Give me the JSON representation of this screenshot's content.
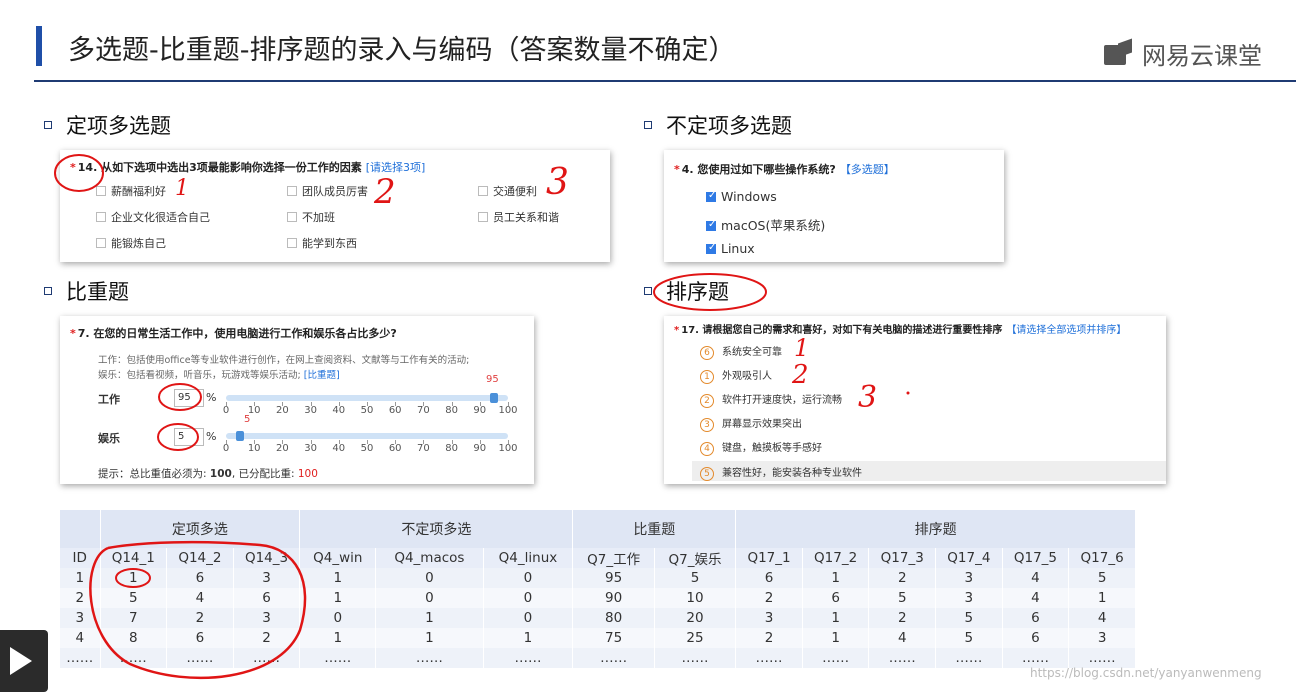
{
  "title": "多选题-比重题-排序题的录入与编码（答案数量不确定）",
  "brand": "网易云课堂",
  "sections": {
    "fixed_multi": "定项多选题",
    "open_multi": "不定项多选题",
    "weight": "比重题",
    "rank": "排序题"
  },
  "q14": {
    "req": "*",
    "label": "14. 从如下选项中选出3项最能影响你选择一份工作的因素",
    "tag": "[请选择3项]",
    "options": [
      "薪酬福利好",
      "团队成员厉害",
      "交通便利",
      "企业文化很适合自己",
      "不加班",
      "员工关系和谐",
      "能锻炼自己",
      "能学到东西"
    ]
  },
  "q4": {
    "req": "*",
    "label": "4.   您使用过如下哪些操作系统?",
    "tag": "【多选题】",
    "options": [
      "Windows",
      "macOS(苹果系统)",
      "Linux"
    ]
  },
  "q7": {
    "req": "*",
    "label": "7.   在您的日常生活工作中，使用电脑进行工作和娱乐各占比多少?",
    "desc1": "工作：包括使用office等专业软件进行创作，在网上查阅资料、文献等与工作有关的活动;",
    "desc2": "娱乐：包括看视频，听音乐，玩游戏等娱乐活动;",
    "tag": "[比重题]",
    "rows": [
      {
        "label": "工作",
        "value": "95",
        "unit": "%",
        "marker": "95",
        "pct": 95
      },
      {
        "label": "娱乐",
        "value": "5",
        "unit": "%",
        "marker": "5",
        "pct": 5
      }
    ],
    "ticks": [
      "0",
      "10",
      "20",
      "30",
      "40",
      "50",
      "60",
      "70",
      "80",
      "90",
      "100"
    ],
    "hint_prefix": "提示：总比重值必须为:",
    "hint_total": "100",
    "hint_mid": ", 已分配比重:",
    "hint_assigned": "100"
  },
  "q17": {
    "req": "*",
    "label": "17. 请根据您自己的需求和喜好，对如下有关电脑的描述进行重要性排序",
    "tag": "【请选择全部选项并排序】",
    "items": [
      {
        "rank": "6",
        "text": "系统安全可靠"
      },
      {
        "rank": "1",
        "text": "外观吸引人"
      },
      {
        "rank": "2",
        "text": "软件打开速度快，运行流畅"
      },
      {
        "rank": "3",
        "text": "屏幕显示效果突出"
      },
      {
        "rank": "4",
        "text": "键盘，触摸板等手感好"
      },
      {
        "rank": "5",
        "text": "兼容性好，能安装各种专业软件"
      }
    ]
  },
  "annotations": {
    "a1": "1",
    "a2": "2",
    "a3": "3",
    "b1": "1",
    "b2": "2",
    "b3": "3"
  },
  "table": {
    "groups": [
      "定项多选",
      "不定项多选",
      "比重题",
      "排序题"
    ],
    "headers": [
      "ID",
      "Q14_1",
      "Q14_2",
      "Q14_3",
      "Q4_win",
      "Q4_macos",
      "Q4_linux",
      "Q7_工作",
      "Q7_娱乐",
      "Q17_1",
      "Q17_2",
      "Q17_3",
      "Q17_4",
      "Q17_5",
      "Q17_6"
    ],
    "rows": [
      [
        "1",
        "1",
        "6",
        "3",
        "1",
        "0",
        "0",
        "95",
        "5",
        "6",
        "1",
        "2",
        "3",
        "4",
        "5"
      ],
      [
        "2",
        "5",
        "4",
        "6",
        "1",
        "0",
        "0",
        "90",
        "10",
        "2",
        "6",
        "5",
        "3",
        "4",
        "1"
      ],
      [
        "3",
        "7",
        "2",
        "3",
        "0",
        "1",
        "0",
        "80",
        "20",
        "3",
        "1",
        "2",
        "5",
        "6",
        "4"
      ],
      [
        "4",
        "8",
        "6",
        "2",
        "1",
        "1",
        "1",
        "75",
        "25",
        "2",
        "1",
        "4",
        "5",
        "6",
        "3"
      ],
      [
        "……",
        "……",
        "……",
        "……",
        "……",
        "……",
        "……",
        "……",
        "……",
        "……",
        "……",
        "……",
        "……",
        "……",
        "……"
      ]
    ]
  },
  "watermark": "https://blog.csdn.net/yanyanwenmeng",
  "colors": {
    "accent": "#1f4fa8",
    "annotation": "#e01515",
    "link": "#1e6fd9",
    "rank": "#e38a2c"
  }
}
